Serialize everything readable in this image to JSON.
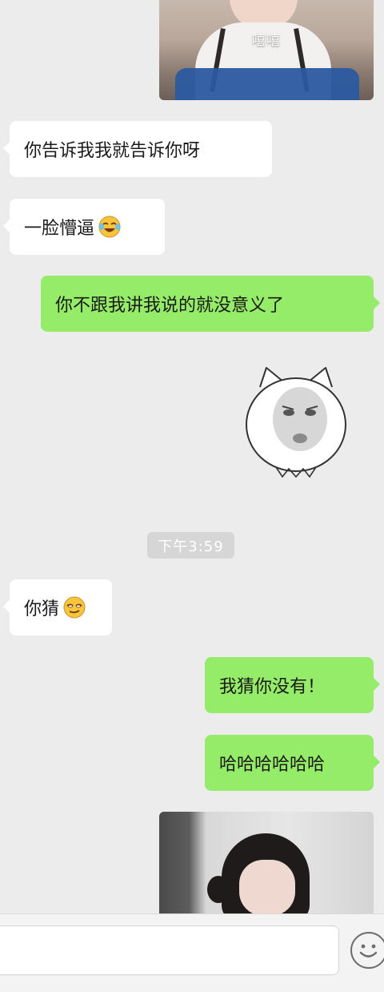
{
  "photo_top": {
    "caption": "嘻嘻"
  },
  "messages": [
    {
      "side": "left",
      "text": "你告诉我我就告诉你呀"
    },
    {
      "side": "left",
      "text": "一脸懵逼",
      "emoji": "tears-of-joy-emoji"
    },
    {
      "side": "right",
      "text": "你不跟我讲我说的就没意义了"
    },
    {
      "side": "left",
      "text": "你猜",
      "emoji": "smirk-emoji"
    },
    {
      "side": "right",
      "text": "我猜你没有！"
    },
    {
      "side": "right",
      "text": "哈哈哈哈哈哈"
    }
  ],
  "timestamp": "下午3:59",
  "input_bar": {
    "value": "",
    "placeholder": ""
  },
  "colors": {
    "background": "#ececec",
    "bubble_self": "#95ec69",
    "bubble_other": "#ffffff",
    "timestamp_bg": "#d6d6d6"
  },
  "icons": {
    "emoji_button": "emoji-face-icon"
  }
}
